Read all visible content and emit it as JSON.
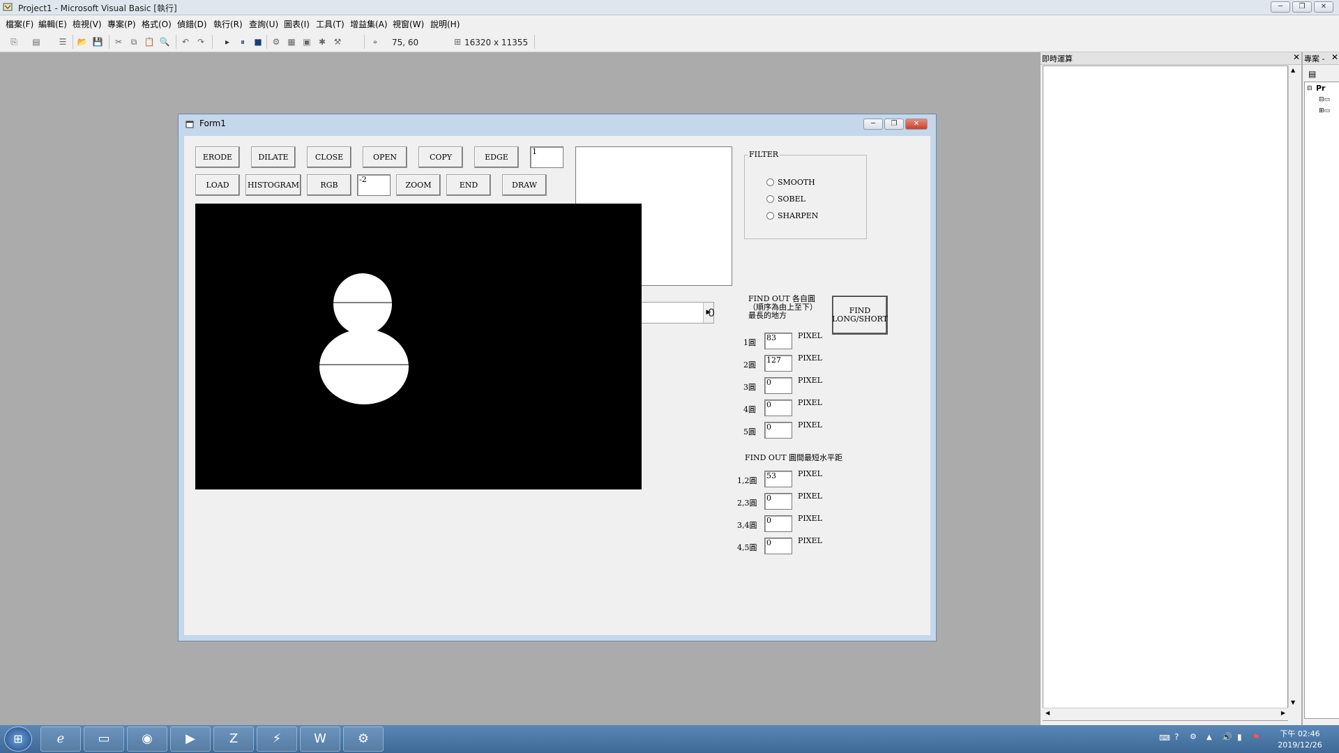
{
  "window": {
    "title": "Project1 - Microsoft Visual Basic [執行]"
  },
  "menu": [
    "檔案(F)",
    "編輯(E)",
    "檢視(V)",
    "專案(P)",
    "格式(O)",
    "偵錯(D)",
    "執行(R)",
    "查詢(U)",
    "圖表(I)",
    "工具(T)",
    "增益集(A)",
    "視窗(W)",
    "說明(H)"
  ],
  "toolbar": {
    "position": "75, 60",
    "size": "16320 x 11355"
  },
  "form": {
    "title": "Form1",
    "buttons_row1": [
      "ERODE",
      "DILATE",
      "CLOSE",
      "OPEN",
      "COPY",
      "EDGE"
    ],
    "buttons_row2": [
      "LOAD",
      "HISTOGRAM",
      "RGB",
      "ZOOM",
      "END",
      "DRAW"
    ],
    "textbox_top": "1",
    "textbox_row2": "-2",
    "scroll_value": "0",
    "filter": {
      "title": "FILTER",
      "options": [
        "SMOOTH",
        "SOBEL",
        "SHARPEN"
      ]
    },
    "find_longest": {
      "label_line1": "FIND OUT 各自圓",
      "label_line2": "（順序為由上至下）",
      "label_line3": "最長的地方",
      "button": "FIND LONG/SHORT"
    },
    "circle_rows": [
      {
        "label": "1圓",
        "value": "83",
        "unit": "PIXEL"
      },
      {
        "label": "2圓",
        "value": "127",
        "unit": "PIXEL"
      },
      {
        "label": "3圓",
        "value": "0",
        "unit": "PIXEL"
      },
      {
        "label": "4圓",
        "value": "0",
        "unit": "PIXEL"
      },
      {
        "label": "5圓",
        "value": "0",
        "unit": "PIXEL"
      }
    ],
    "distance_title": "FIND OUT 圓間最短水平距",
    "distance_rows": [
      {
        "label": "1,2圓",
        "value": "53",
        "unit": "PIXEL"
      },
      {
        "label": "2,3圓",
        "value": "0",
        "unit": "PIXEL"
      },
      {
        "label": "3,4圓",
        "value": "0",
        "unit": "PIXEL"
      },
      {
        "label": "4,5圓",
        "value": "0",
        "unit": "PIXEL"
      }
    ]
  },
  "immediate": {
    "title": "即時運算"
  },
  "project": {
    "title": "專案 -",
    "root": "Pr"
  },
  "tray": {
    "time": "下午 02:46",
    "date": "2019/12/26"
  },
  "colors": {
    "accent": "#3d6996",
    "canvas": "#000000"
  }
}
